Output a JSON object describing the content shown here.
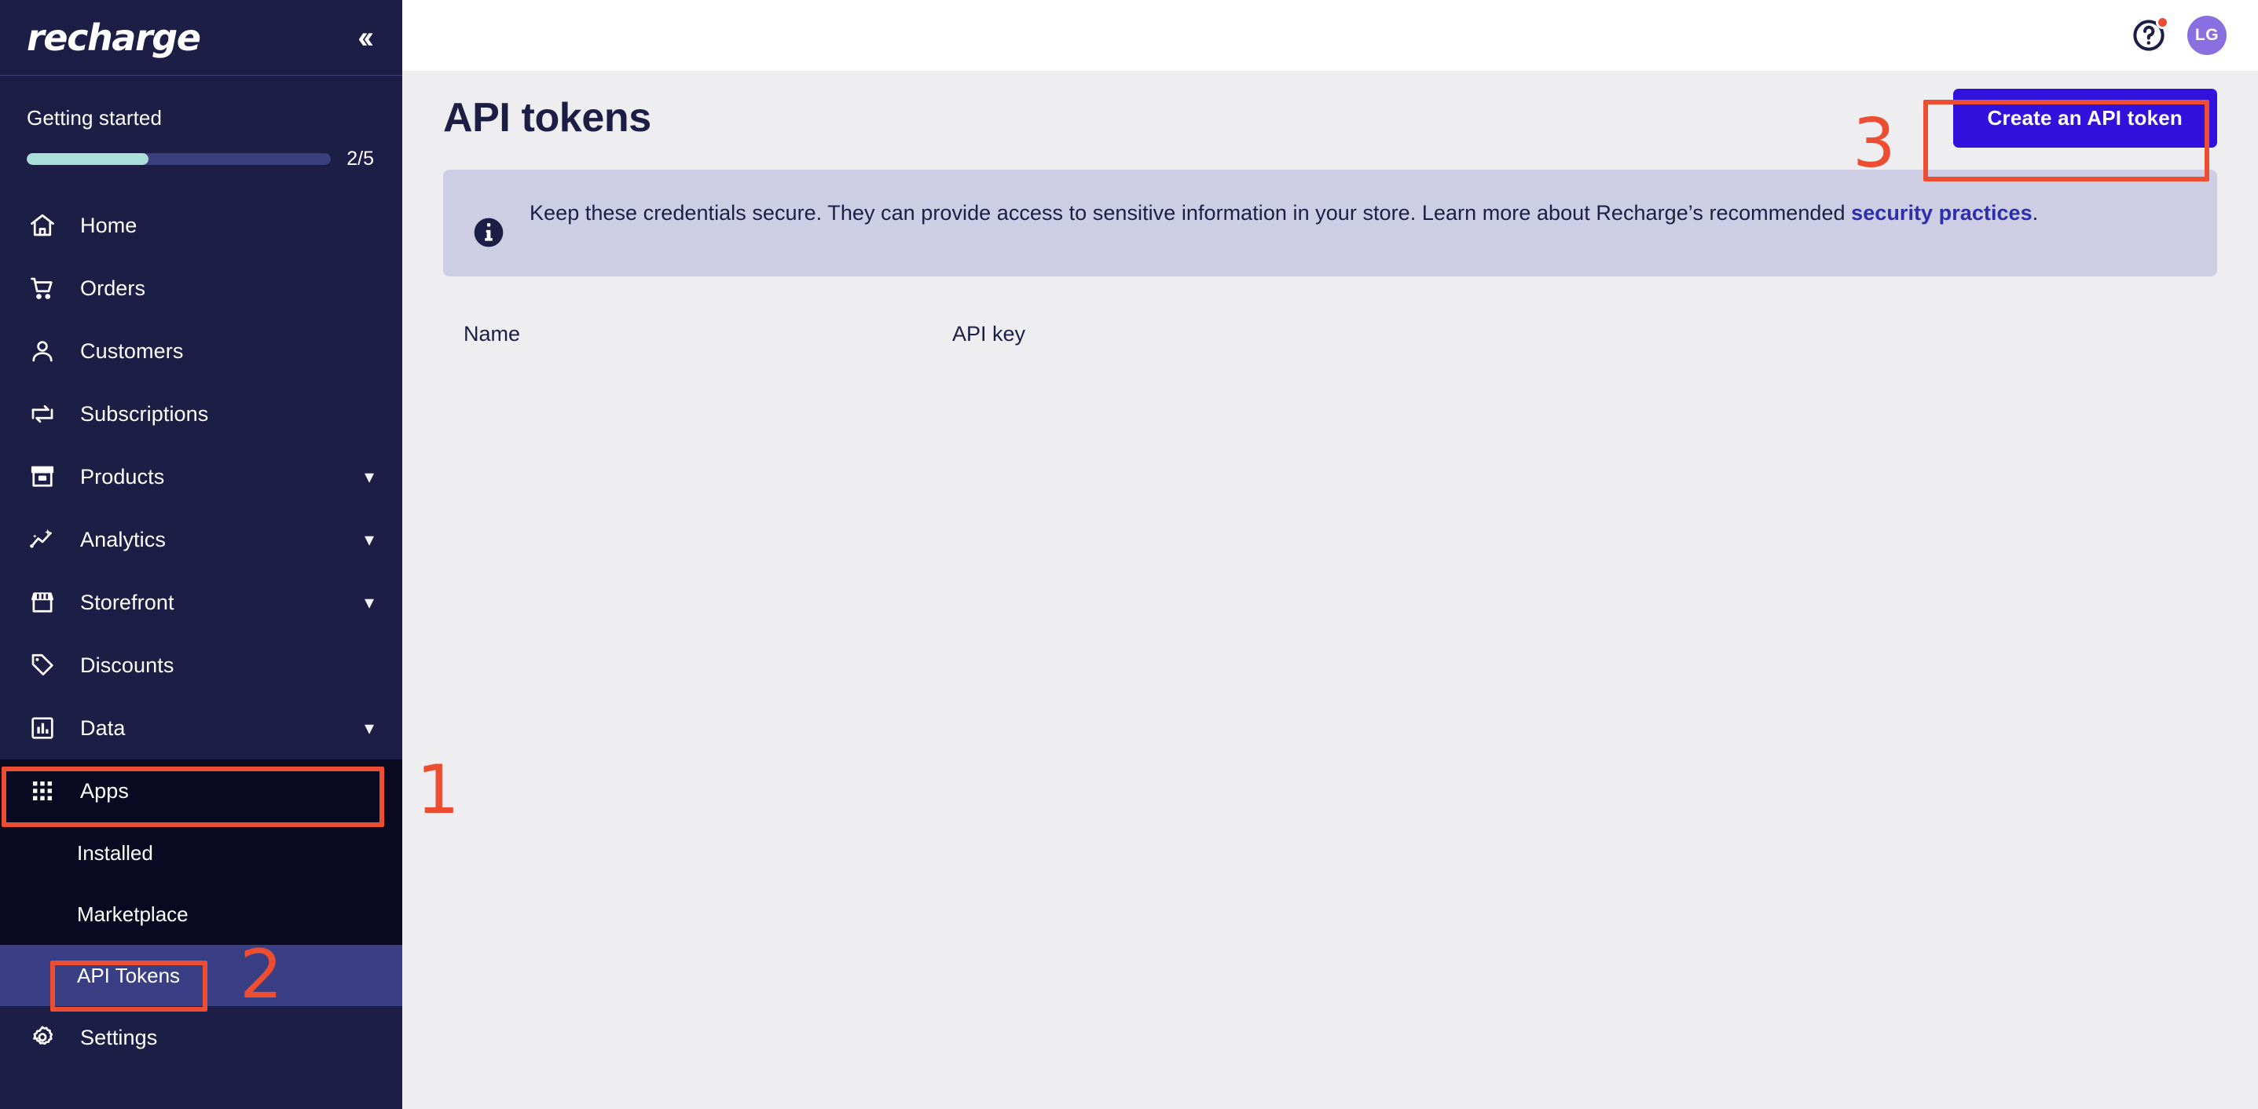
{
  "brand": {
    "logo_text": "recharge",
    "collapse_icon": "chevron-double-left-icon"
  },
  "getting_started": {
    "title": "Getting started",
    "progress_label": "2/5",
    "progress_percent": 40,
    "fill_color": "#a9ded9",
    "track_color": "#3a3f80"
  },
  "sidebar": {
    "items": [
      {
        "label": "Home",
        "icon": "home-icon",
        "expandable": false
      },
      {
        "label": "Orders",
        "icon": "cart-icon",
        "expandable": false
      },
      {
        "label": "Customers",
        "icon": "person-icon",
        "expandable": false
      },
      {
        "label": "Subscriptions",
        "icon": "repeat-icon",
        "expandable": false
      },
      {
        "label": "Products",
        "icon": "box-icon",
        "expandable": true
      },
      {
        "label": "Analytics",
        "icon": "analytics-icon",
        "expandable": true
      },
      {
        "label": "Storefront",
        "icon": "storefront-icon",
        "expandable": true
      },
      {
        "label": "Discounts",
        "icon": "tag-icon",
        "expandable": false
      },
      {
        "label": "Data",
        "icon": "bar-chart-icon",
        "expandable": true
      }
    ],
    "apps": {
      "label": "Apps",
      "icon": "grid-icon",
      "expanded": true,
      "children": [
        {
          "label": "Installed",
          "active": false
        },
        {
          "label": "Marketplace",
          "active": false
        },
        {
          "label": "API Tokens",
          "active": true
        }
      ]
    },
    "settings": {
      "label": "Settings",
      "icon": "gear-icon"
    },
    "chevron_glyph": "⌄"
  },
  "topbar": {
    "help_icon": "help-circle-icon",
    "help_has_notification": true,
    "avatar_initials": "LG",
    "avatar_color": "#8a6fe0"
  },
  "page": {
    "title": "API tokens",
    "create_button": "Create an API token",
    "create_button_color": "#3311dd"
  },
  "banner": {
    "icon": "info-icon",
    "text_before": "Keep these credentials secure. They can provide access to sensitive information in your store. Learn more about Recharge’s recommended ",
    "link_text": "security practices",
    "text_after": ".",
    "background": "#cdcde4"
  },
  "table": {
    "columns": [
      "Name",
      "API key"
    ],
    "rows": []
  },
  "annotations": {
    "color": "#ed4d30",
    "steps": [
      {
        "number": "1",
        "target": "sidebar-item-apps"
      },
      {
        "number": "2",
        "target": "sidebar-subitem-api-tokens"
      },
      {
        "number": "3",
        "target": "create-api-token-button"
      }
    ]
  }
}
